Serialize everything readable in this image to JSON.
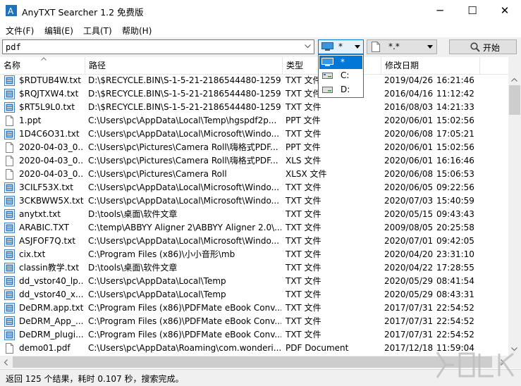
{
  "window": {
    "title": "AnyTXT Searcher 1.2 免费版",
    "minimize": "─",
    "maximize": "☐",
    "close": "✕"
  },
  "menu": [
    "文件(F)",
    "编辑(E)",
    "工具(T)",
    "帮助(H)"
  ],
  "search": {
    "value": "pdf"
  },
  "drive_filter": {
    "selected": "*"
  },
  "drive_dropdown": {
    "options": [
      "*",
      "C:",
      "D:"
    ]
  },
  "ext_filter": {
    "selected": "*.*"
  },
  "start_button": {
    "label": "开始",
    "icon": "magnifier-icon"
  },
  "columns": [
    "名称",
    "路径",
    "类型",
    "修改日期"
  ],
  "rows": [
    {
      "name": "$RDTUB4W.txt",
      "path": "D:\\$RECYCLE.BIN\\S-1-5-21-2186544480-1259...",
      "type": "TXT 文件",
      "date": "2019/04/26",
      "time": "16:21:46",
      "icon": "txt"
    },
    {
      "name": "$RQJTXW4.txt",
      "path": "D:\\$RECYCLE.BIN\\S-1-5-21-2186544480-1259...",
      "type": "TXT 文件",
      "date": "2016/04/16",
      "time": "11:12:42",
      "icon": "txt"
    },
    {
      "name": "$RT5L9L0.txt",
      "path": "D:\\$RECYCLE.BIN\\S-1-5-21-2186544480-1259...",
      "type": "TXT 文件",
      "date": "2016/08/03",
      "time": "14:21:33",
      "icon": "txt"
    },
    {
      "name": "1.ppt",
      "path": "C:\\Users\\pc\\AppData\\Local\\Temp\\hgspdf2p...",
      "type": "PPT 文件",
      "date": "2020/06/01",
      "time": "15:02:56",
      "icon": "doc"
    },
    {
      "name": "1D4C6O31.txt",
      "path": "C:\\Users\\pc\\AppData\\Local\\Microsoft\\Windo...",
      "type": "TXT 文件",
      "date": "2020/06/08",
      "time": "17:05:21",
      "icon": "txt"
    },
    {
      "name": "2020-04-03_0...",
      "path": "C:\\Users\\pc\\Pictures\\Camera Roll\\嗨格式PDF...",
      "type": "PPT 文件",
      "date": "2020/06/01",
      "time": "15:02:56",
      "icon": "doc"
    },
    {
      "name": "2020-04-03_0...",
      "path": "C:\\Users\\pc\\Pictures\\Camera Roll\\嗨格式PDF...",
      "type": "XLS 文件",
      "date": "2020/06/01",
      "time": "16:16:46",
      "icon": "doc"
    },
    {
      "name": "2020-04-03_0...",
      "path": "C:\\Users\\pc\\Pictures\\Camera Roll",
      "type": "XLSX 文件",
      "date": "2020/06/08",
      "time": "15:06:53",
      "icon": "doc"
    },
    {
      "name": "3CILF53X.txt",
      "path": "C:\\Users\\pc\\AppData\\Local\\Microsoft\\Windo...",
      "type": "TXT 文件",
      "date": "2020/06/05",
      "time": "09:22:56",
      "icon": "txt"
    },
    {
      "name": "3CKBWW5X.txt",
      "path": "C:\\Users\\pc\\AppData\\Local\\Microsoft\\Windo...",
      "type": "TXT 文件",
      "date": "2020/07/03",
      "time": "15:40:59",
      "icon": "txt"
    },
    {
      "name": "anytxt.txt",
      "path": "D:\\tools\\桌面\\软件文章",
      "type": "TXT 文件",
      "date": "2020/05/15",
      "time": "09:43:43",
      "icon": "txt"
    },
    {
      "name": "ARABIC.TXT",
      "path": "C:\\temp\\ABBYY Aligner 2\\ABBYY Aligner 2.0\\...",
      "type": "TXT 文件",
      "date": "2009/08/05",
      "time": "20:25:58",
      "icon": "txt"
    },
    {
      "name": "ASJFOF7Q.txt",
      "path": "C:\\Users\\pc\\AppData\\Local\\Microsoft\\Windo...",
      "type": "TXT 文件",
      "date": "2020/07/01",
      "time": "09:42:05",
      "icon": "txt"
    },
    {
      "name": "cix.txt",
      "path": "C:\\Program Files (x86)\\小小音形\\mb",
      "type": "TXT 文件",
      "date": "2020/04/20",
      "time": "23:31:10",
      "icon": "txt"
    },
    {
      "name": "classin教学.txt",
      "path": "D:\\tools\\桌面\\软件文章",
      "type": "TXT 文件",
      "date": "2020/04/22",
      "time": "17:28:55",
      "icon": "txt"
    },
    {
      "name": "dd_vstor40_lp...",
      "path": "C:\\Users\\pc\\AppData\\Local\\Temp",
      "type": "TXT 文件",
      "date": "2020/05/29",
      "time": "08:41:54",
      "icon": "txt"
    },
    {
      "name": "dd_vstor40_x...",
      "path": "C:\\Users\\pc\\AppData\\Local\\Temp",
      "type": "TXT 文件",
      "date": "2020/05/29",
      "time": "08:43:31",
      "icon": "txt"
    },
    {
      "name": "DeDRM.app.txt",
      "path": "C:\\Program Files (x86)\\PDFMate eBook Conv...",
      "type": "TXT 文件",
      "date": "2017/07/31",
      "time": "22:54:52",
      "icon": "txt"
    },
    {
      "name": "DeDRM_App_...",
      "path": "C:\\Program Files (x86)\\PDFMate eBook Conv...",
      "type": "TXT 文件",
      "date": "2017/07/31",
      "time": "22:54:52",
      "icon": "txt"
    },
    {
      "name": "DeDRM_plugi...",
      "path": "C:\\Program Files (x86)\\PDFMate eBook Conv...",
      "type": "TXT 文件",
      "date": "2017/07/31",
      "time": "22:54:52",
      "icon": "txt"
    },
    {
      "name": "demo01.pdf",
      "path": "C:\\Users\\pc\\AppData\\Roaming\\com.wonderi...",
      "type": "PDF Document",
      "date": "2017/12/18",
      "time": "11:59:04",
      "icon": "doc"
    }
  ],
  "status": {
    "text": "返回 125 个结果，耗时 0.107 秒，搜索完成。"
  },
  "colors": {
    "accent": "#0078d7",
    "selection": "#cce8ff",
    "txt_icon": "#3f7fbf"
  }
}
